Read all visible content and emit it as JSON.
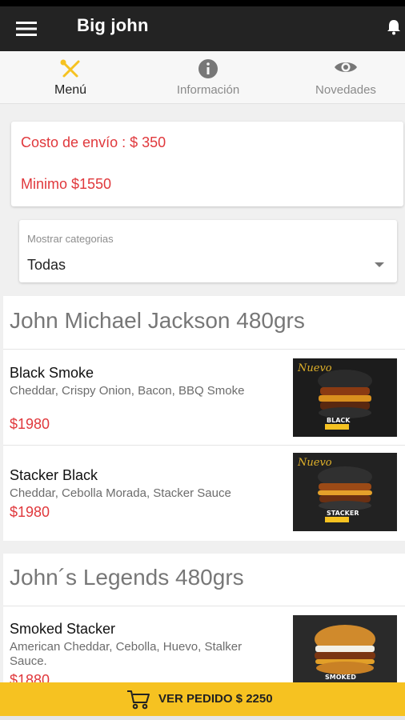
{
  "app_bar": {
    "title": "Big john"
  },
  "tabs": [
    {
      "label": "Menú",
      "icon": "fork-knife-icon",
      "active": true
    },
    {
      "label": "Información",
      "icon": "info-icon",
      "active": false
    },
    {
      "label": "Novedades",
      "icon": "eye-icon",
      "active": false
    }
  ],
  "delivery": {
    "cost": "Costo de envío : $ 350",
    "minimum": "Minimo $1550"
  },
  "category_select": {
    "label": "Mostrar categorias",
    "value": "Todas"
  },
  "sections": [
    {
      "title": "John Michael Jackson 480grs",
      "items": [
        {
          "name": "Black Smoke",
          "description": "Cheddar, Crispy Onion, Bacon, BBQ Smoke",
          "price": "$1980",
          "image": "black-smoke-burger"
        },
        {
          "name": "Stacker Black",
          "description": "Cheddar, Cebolla Morada, Stacker Sauce",
          "price": "$1980",
          "image": "stacker-black-burger"
        }
      ]
    },
    {
      "title": "John´s Legends 480grs",
      "items": [
        {
          "name": "Smoked Stacker",
          "description": "American Cheddar, Cebolla, Huevo, Stalker Sauce.",
          "price": "$1880",
          "image": "smoked-stacker-burger"
        }
      ]
    }
  ],
  "order_bar": {
    "label": "VER PEDIDO $ 2250"
  },
  "colors": {
    "accent": "#f6c221",
    "price": "#e0383c",
    "app_bar": "#232323"
  }
}
